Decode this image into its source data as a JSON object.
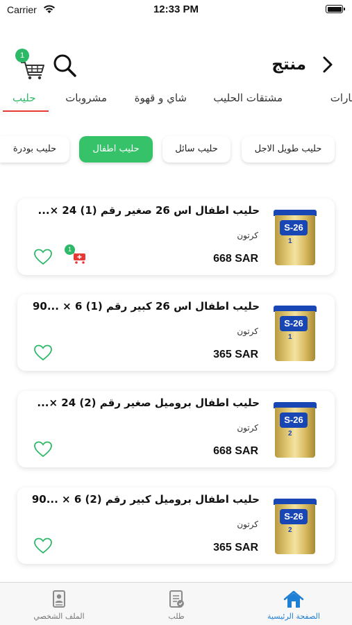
{
  "status_bar": {
    "carrier": "Carrier",
    "time": "12:33 PM"
  },
  "header": {
    "title": "منتج",
    "cart_count": "1"
  },
  "category_tabs": [
    {
      "label": "حليب",
      "active": true
    },
    {
      "label": "مشروبات",
      "active": false
    },
    {
      "label": "شاي و قهوة",
      "active": false
    },
    {
      "label": "مشتقات الحليب",
      "active": false
    },
    {
      "label": "بهارات",
      "active": false
    }
  ],
  "subcategories": [
    {
      "label": "حليب طويل الاجل",
      "active": false
    },
    {
      "label": "حليب سائل",
      "active": false
    },
    {
      "label": "حليب اطفال",
      "active": true
    },
    {
      "label": "حليب بودرة",
      "active": false
    }
  ],
  "products": [
    {
      "name": "حليب اطفال اس 26 صغير رقم (1) 24 ×...",
      "unit": "كرتون",
      "price": "668 SAR",
      "in_cart": "1",
      "can_text": "S-26",
      "can_stage": "1"
    },
    {
      "name": "حليب اطفال اس 26 كبير رقم (1) 6 × ...90",
      "unit": "كرتون",
      "price": "365 SAR",
      "in_cart": "",
      "can_text": "S-26",
      "can_stage": "1"
    },
    {
      "name": "حليب اطفال بروميل صغير رقم (2) 24 ×...",
      "unit": "كرتون",
      "price": "668 SAR",
      "in_cart": "",
      "can_text": "S-26",
      "can_stage": "2"
    },
    {
      "name": "حليب اطفال بروميل كبير رقم (2) 6 × ...90",
      "unit": "كرتون",
      "price": "365 SAR",
      "in_cart": "",
      "can_text": "S-26",
      "can_stage": "2"
    }
  ],
  "bottom_nav": [
    {
      "label": "الصفحة الرئيسية",
      "icon": "home-icon",
      "active": true
    },
    {
      "label": "طلب",
      "icon": "order-icon",
      "active": false
    },
    {
      "label": "الملف الشخصي",
      "icon": "profile-icon",
      "active": false
    }
  ],
  "colors": {
    "accent_green": "#35c268",
    "tab_underline": "#e53935",
    "nav_active": "#1e7fd4",
    "can_blue": "#1846b5"
  }
}
